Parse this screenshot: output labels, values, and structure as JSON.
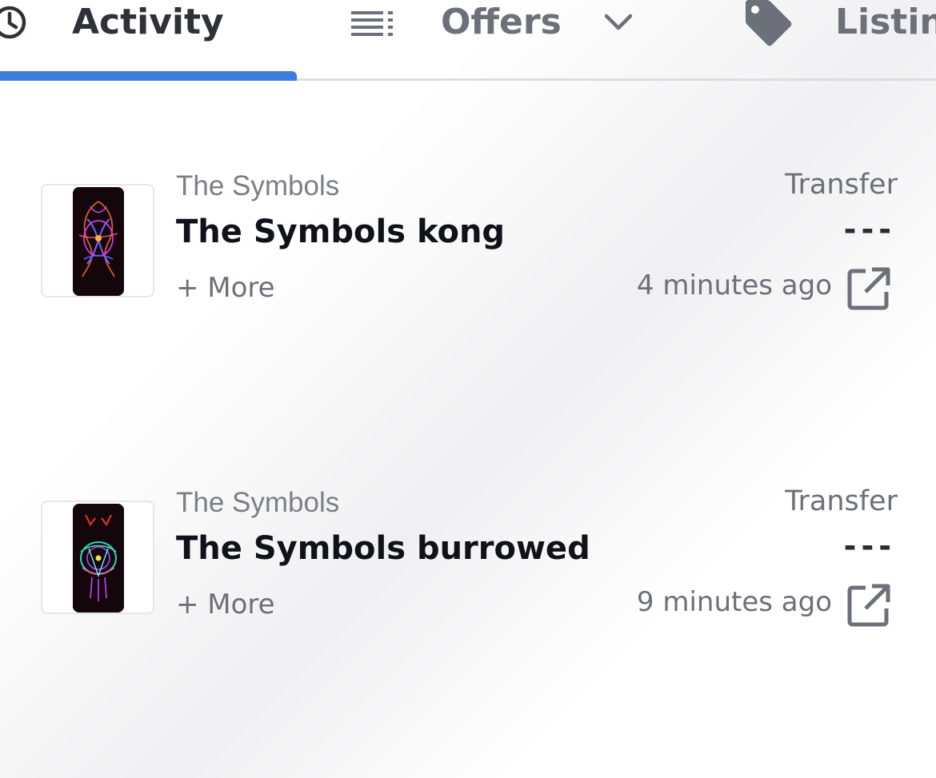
{
  "tabs": [
    {
      "label": "Activity",
      "icon": "clock-icon",
      "active": true
    },
    {
      "label": "Offers",
      "icon": "list-icon",
      "dropdown": true
    },
    {
      "label": "Listin",
      "icon": "tag-icon"
    }
  ],
  "activity": [
    {
      "collection": "The Symbols",
      "name": "The Symbols kong",
      "more": "+ More",
      "event": "Transfer",
      "price": "---",
      "time": "4 minutes ago"
    },
    {
      "collection": "The Symbols",
      "name": "The Symbols burrowed",
      "more": "+ More",
      "event": "Transfer",
      "price": "---",
      "time": "9 minutes ago"
    }
  ],
  "colors": {
    "accent": "#3b7ddd",
    "muted_text": "#6b7079",
    "primary_text": "#0f1218",
    "thumb_bg": "#14070b"
  }
}
